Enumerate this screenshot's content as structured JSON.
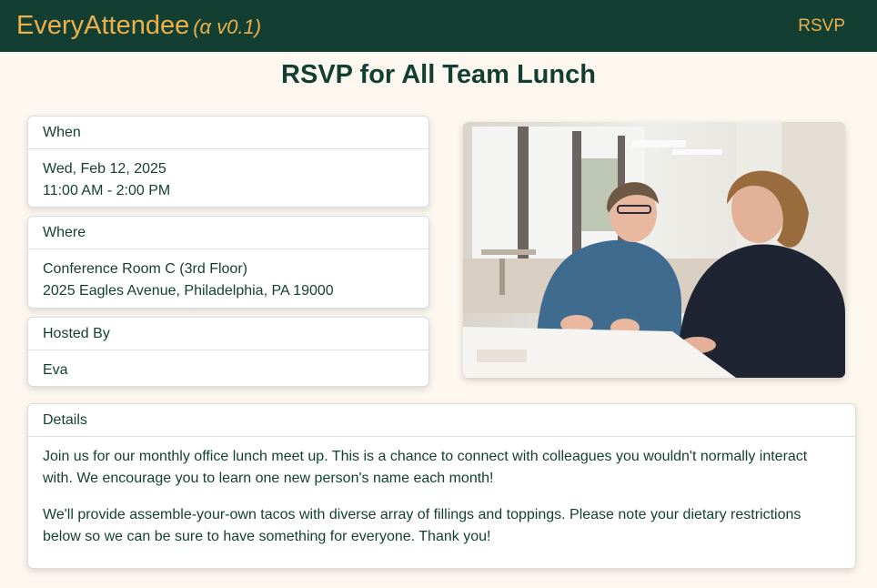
{
  "navbar": {
    "brand": "EveryAttendee",
    "version": "(α v0.1)",
    "rsvp_link": "RSVP"
  },
  "page": {
    "title": "RSVP for All Team Lunch"
  },
  "when": {
    "header": "When",
    "date": "Wed, Feb 12, 2025",
    "time": "11:00 AM - 2:00 PM"
  },
  "where": {
    "header": "Where",
    "room": "Conference Room C (3rd Floor)",
    "address": "2025 Eagles Avenue, Philadelphia, PA 19000"
  },
  "hosted_by": {
    "header": "Hosted By",
    "host": "Eva"
  },
  "details": {
    "header": "Details",
    "paragraph_1": "Join us for our monthly office lunch meet up. This is a chance to connect with colleagues you wouldn't normally interact with. We encourage you to learn one new person's name each month!",
    "paragraph_2": "We'll provide assemble-your-own tacos with diverse array of fillings and toppings. Please note your dietary restrictions below so we can be sure to have something for everyone. Thank you!"
  },
  "colors": {
    "navbar_bg": "#123f31",
    "brand_accent": "#eeb04a",
    "page_bg": "#fdf8ef",
    "text": "#123f31"
  }
}
